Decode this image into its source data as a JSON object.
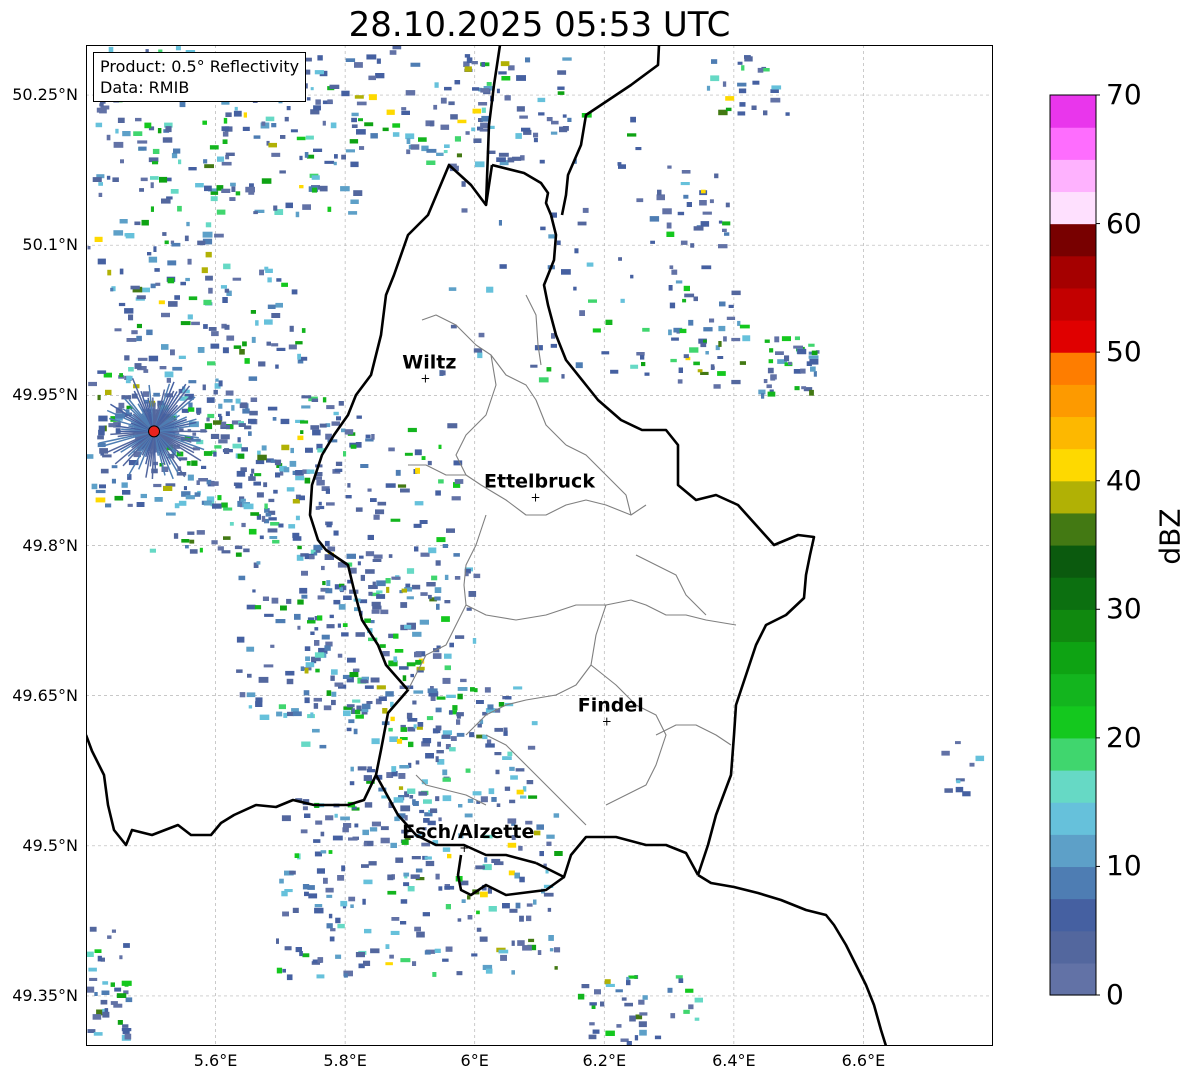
{
  "title": "28.10.2025 05:53 UTC",
  "info": {
    "product": "Product: 0.5° Reflectivity",
    "data_source": "Data: RMIB"
  },
  "map": {
    "lon_range": [
      5.4,
      6.8
    ],
    "lat_range": [
      49.3,
      50.3
    ],
    "lat_ticks": [
      {
        "value": 50.25,
        "label": "50.25°N"
      },
      {
        "value": 50.1,
        "label": "50.1°N"
      },
      {
        "value": 49.95,
        "label": "49.95°N"
      },
      {
        "value": 49.8,
        "label": "49.8°N"
      },
      {
        "value": 49.65,
        "label": "49.65°N"
      },
      {
        "value": 49.5,
        "label": "49.5°N"
      },
      {
        "value": 49.35,
        "label": "49.35°N"
      }
    ],
    "lon_ticks": [
      {
        "value": 5.6,
        "label": "5.6°E"
      },
      {
        "value": 5.8,
        "label": "5.8°E"
      },
      {
        "value": 6.0,
        "label": "6°E"
      },
      {
        "value": 6.2,
        "label": "6.2°E"
      },
      {
        "value": 6.4,
        "label": "6.4°E"
      },
      {
        "value": 6.6,
        "label": "6.6°E"
      }
    ],
    "cities": [
      {
        "name": "Wiltz",
        "lon": 5.93,
        "lat": 49.967
      },
      {
        "name": "Ettelbruck",
        "lon": 6.1,
        "lat": 49.848
      },
      {
        "name": "Findel",
        "lon": 6.21,
        "lat": 49.624
      },
      {
        "name": "Esch/Alzette",
        "lon": 5.99,
        "lat": 49.498
      }
    ],
    "radar_site": {
      "lon": 5.505,
      "lat": 49.914,
      "color": "#e8231e"
    }
  },
  "colorbar": {
    "label": "dBZ",
    "min": 0,
    "max": 70,
    "ticks": [
      "0",
      "10",
      "20",
      "30",
      "40",
      "50",
      "60",
      "70"
    ],
    "colors": [
      "#6272a6",
      "#53679e",
      "#4560a1",
      "#4e7db3",
      "#5da0c8",
      "#66c1db",
      "#66d9c5",
      "#40d66e",
      "#14c81e",
      "#13b51e",
      "#0ea313",
      "#10890f",
      "#0c7010",
      "#0b5a0e",
      "#437913",
      "#b1b105",
      "#fed900",
      "#fdb800",
      "#fd9a00",
      "#fe7d00",
      "#e00000",
      "#c30000",
      "#a50000",
      "#780000",
      "#fee0fe",
      "#feb2fe",
      "#fe6dfe",
      "#e936ec"
    ]
  }
}
